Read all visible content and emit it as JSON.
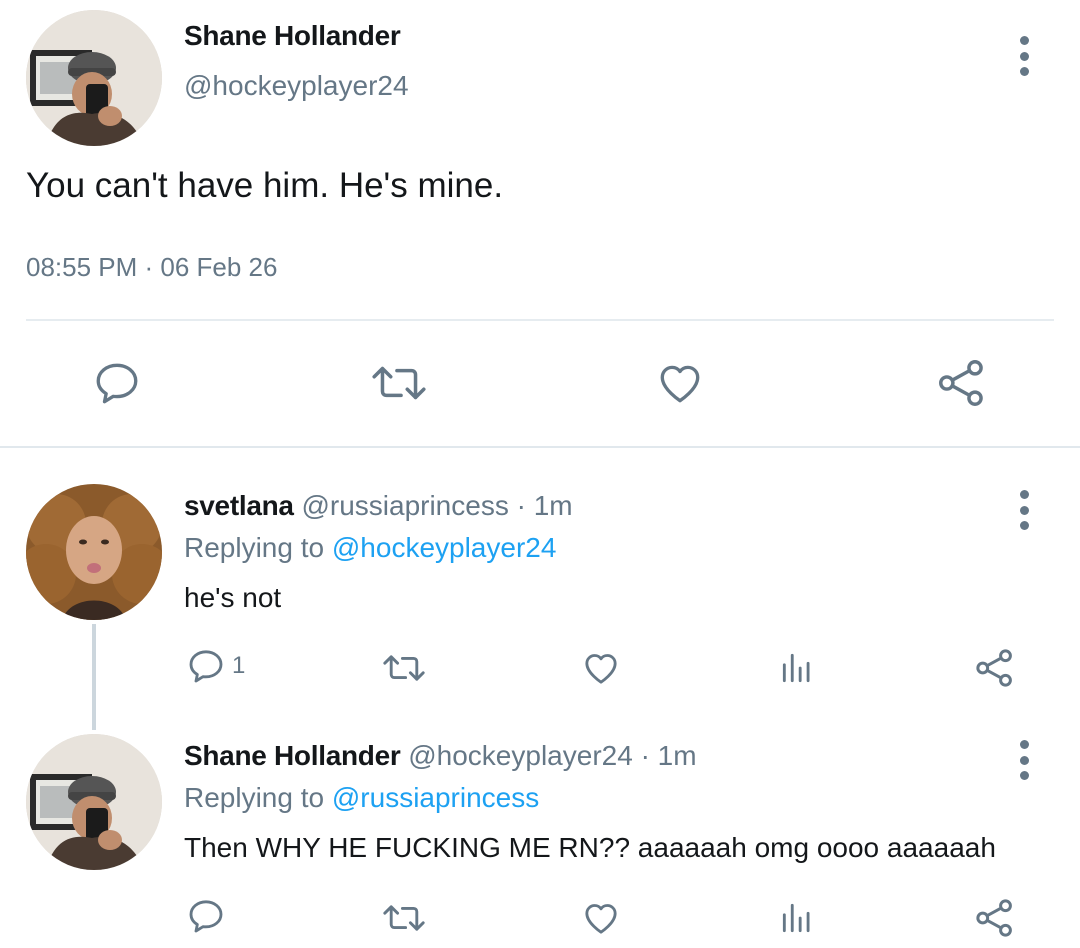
{
  "main_tweet": {
    "name": "Shane Hollander",
    "handle": "@hockeyplayer24",
    "text": "You can't have him. He's mine.",
    "timestamp": "08:55 PM · 06 Feb 26",
    "actions": [
      "reply-icon",
      "retweet-icon",
      "like-icon",
      "share-icon"
    ]
  },
  "replies": [
    {
      "name": "svetlana",
      "handle": "@russiaprincess",
      "time": "· 1m",
      "replying_label": "Replying to",
      "replying_to": "@hockeyplayer24",
      "text": "he's not",
      "reply_count": "1"
    },
    {
      "name": "Shane Hollander",
      "handle": "@hockeyplayer24",
      "time": "· 1m",
      "replying_label": "Replying to",
      "replying_to": "@russiaprincess",
      "text": "Then WHY HE FUCKING ME RN?? aaaaaah omg oooo aaaaaah",
      "reply_count": ""
    }
  ],
  "colors": {
    "text": "#14171a",
    "secondary": "#657786",
    "link": "#1da1f2",
    "divider": "#e6ecf0"
  }
}
